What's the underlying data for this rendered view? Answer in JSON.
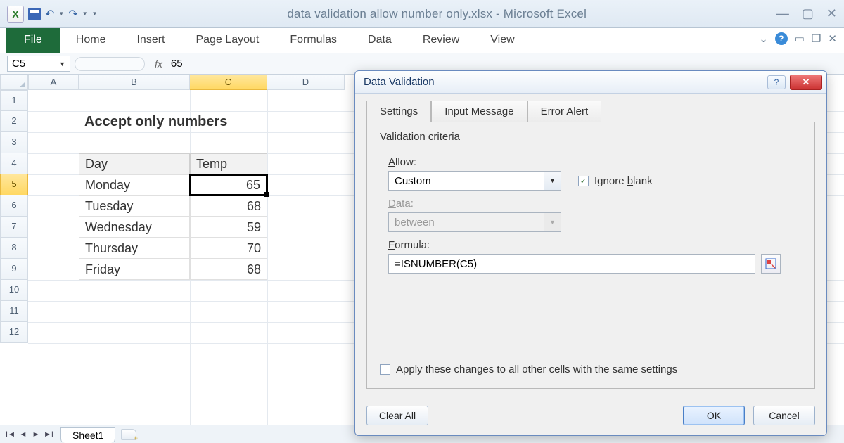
{
  "window": {
    "title": "data validation allow number only.xlsx - Microsoft Excel",
    "qat_undo": "↶",
    "qat_redo": "↷"
  },
  "ribbon": {
    "tabs": [
      "File",
      "Home",
      "Insert",
      "Page Layout",
      "Formulas",
      "Data",
      "Review",
      "View"
    ],
    "help_glyph": "?",
    "chevron": "⌄"
  },
  "namebox": "C5",
  "formula_bar": "65",
  "columns": [
    "A",
    "B",
    "C",
    "D"
  ],
  "rows": [
    "1",
    "2",
    "3",
    "4",
    "5",
    "6",
    "7",
    "8",
    "9",
    "10",
    "11",
    "12"
  ],
  "heading": "Accept only numbers",
  "table": {
    "headers": [
      "Day",
      "Temp"
    ],
    "rows": [
      [
        "Monday",
        "65"
      ],
      [
        "Tuesday",
        "68"
      ],
      [
        "Wednesday",
        "59"
      ],
      [
        "Thursday",
        "70"
      ],
      [
        "Friday",
        "68"
      ]
    ]
  },
  "sheet_tab": "Sheet1",
  "dialog": {
    "title": "Data Validation",
    "tabs": [
      "Settings",
      "Input Message",
      "Error Alert"
    ],
    "section": "Validation criteria",
    "allow_label_pre": "A",
    "allow_label_post": "llow:",
    "allow_value": "Custom",
    "ignore_blank_pre": "Ignore ",
    "ignore_blank_u": "b",
    "ignore_blank_post": "lank",
    "ignore_blank_checked": "✓",
    "data_label_pre": "D",
    "data_label_post": "ata:",
    "data_value": "between",
    "formula_label_pre": "F",
    "formula_label_post": "ormula:",
    "formula_value": "=ISNUMBER(C5)",
    "apply_label_pre": "Apply these changes to all other cells with the same settings",
    "clear_pre": "C",
    "clear_post": "lear All",
    "ok": "OK",
    "cancel": "Cancel"
  }
}
